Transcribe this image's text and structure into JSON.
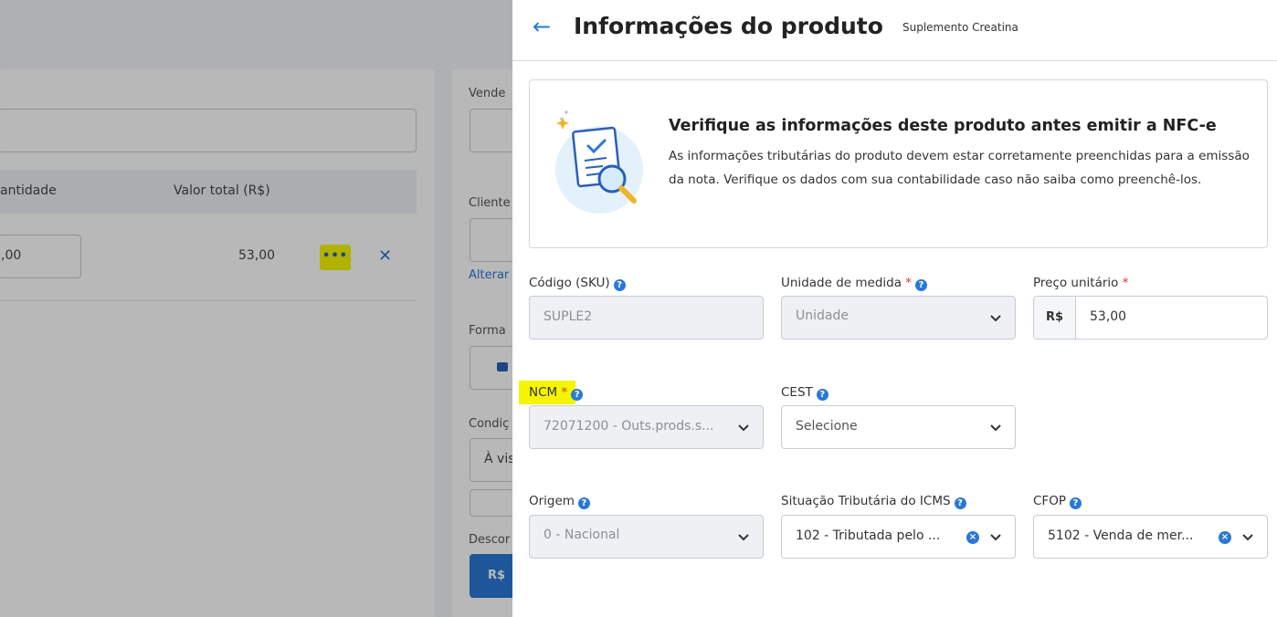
{
  "background": {
    "vendedor_label": "Vende",
    "quantidade_header": "antidade",
    "valor_total_header": "Valor total (R$)",
    "quantidade_value": ",00",
    "valor_total_value": "53,00",
    "more_label": "•••",
    "remove_label": "✕",
    "cliente_label": "Cliente",
    "alterar_link": "Alterar",
    "forma_label": "Forma",
    "condicao_label": "Condiç",
    "condicao_value": "À vis",
    "desconto_label": "Descor",
    "desconto_currency": "R$"
  },
  "drawer": {
    "back_icon": "arrow-left-icon",
    "title": "Informações do produto",
    "subtitle": "Suplemento Creatina",
    "notice": {
      "title": "Verifique as informações deste produto antes emitir a NFC-e",
      "body": "As informações tributárias do produto devem estar corretamente preenchidas para a emissão da nota. Verifique os dados com sua contabilidade caso não saiba como preenchê-los."
    },
    "fields": {
      "sku": {
        "label": "Código (SKU)",
        "value": "SUPLE2"
      },
      "unidade": {
        "label": "Unidade de medida",
        "required": "*",
        "value": "Unidade"
      },
      "preco": {
        "label": "Preço unitário",
        "required": "*",
        "prefix": "R$",
        "value": "53,00"
      },
      "ncm": {
        "label": "NCM",
        "required": "*",
        "value": "72071200 - Outs.prods.s..."
      },
      "cest": {
        "label": "CEST",
        "placeholder": "Selecione"
      },
      "origem": {
        "label": "Origem",
        "value": "0 - Nacional"
      },
      "icms": {
        "label": "Situação Tributária do ICMS",
        "value": "102 - Tributada pelo ..."
      },
      "cfop": {
        "label": "CFOP",
        "value": "5102 - Venda de mer..."
      }
    },
    "help_glyph": "?",
    "clear_glyph": "×"
  },
  "colors": {
    "accent": "#2a78d6",
    "required": "#d9342b",
    "highlight": "#f5f500"
  }
}
